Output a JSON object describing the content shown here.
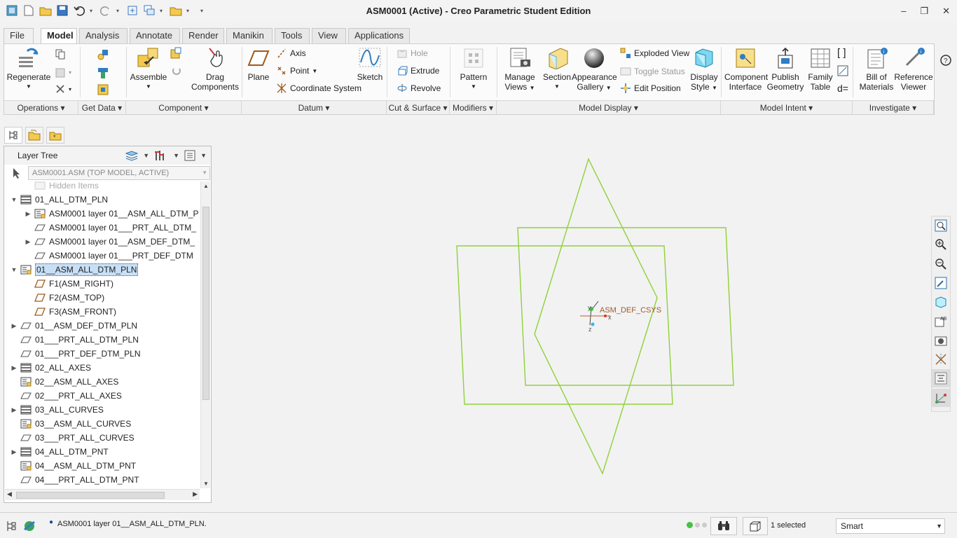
{
  "window": {
    "title": "ASM0001 (Active) - Creo Parametric Student Edition",
    "controls": [
      "–",
      "❐",
      "✕"
    ]
  },
  "menu_tabs": [
    {
      "label": "File",
      "dropdown": "▾"
    },
    {
      "label": "Model"
    },
    {
      "label": "Analysis"
    },
    {
      "label": "Annotate"
    },
    {
      "label": "Render"
    },
    {
      "label": "Manikin"
    },
    {
      "label": "Tools"
    },
    {
      "label": "View"
    },
    {
      "label": "Applications"
    }
  ],
  "ribbon": {
    "operations": {
      "regenerate": "Regenerate"
    },
    "component": {
      "assemble": "Assemble",
      "drag": [
        "Drag",
        "Components"
      ]
    },
    "datum": {
      "plane": "Plane",
      "axis": "Axis",
      "point": "Point",
      "csys": "Coordinate System",
      "sketch": "Sketch"
    },
    "cut_surface": {
      "hole": "Hole",
      "extrude": "Extrude",
      "revolve": "Revolve"
    },
    "modifiers": {
      "pattern": "Pattern"
    },
    "model_display": {
      "manage_views": [
        "Manage",
        "Views"
      ],
      "section": "Section",
      "appearance": [
        "Appearance",
        "Gallery"
      ],
      "exploded_view": "Exploded View",
      "toggle_status": "Toggle Status",
      "edit_position": "Edit Position",
      "display_style": [
        "Display",
        "Style"
      ]
    },
    "model_intent": {
      "component_interface": [
        "Component",
        "Interface"
      ],
      "publish_geometry": [
        "Publish",
        "Geometry"
      ],
      "family_table": [
        "Family",
        "Table"
      ],
      "d_eq": "d="
    },
    "investigate": {
      "bom": [
        "Bill of",
        "Materials"
      ],
      "reference_viewer": [
        "Reference",
        "Viewer"
      ]
    },
    "groups": [
      "Operations",
      "Get Data",
      "Component",
      "Datum",
      "Cut & Surface",
      "Modifiers",
      "Model Display",
      "Model Intent",
      "Investigate"
    ]
  },
  "layer_panel": {
    "title": "Layer Tree",
    "model": "ASM0001.ASM (TOP MODEL, ACTIVE)",
    "items": [
      {
        "label": "Hidden Items",
        "toggle": "",
        "icon": "layer-icon",
        "indent": 1,
        "faded": true
      },
      {
        "label": "01_ALL_DTM_PLN",
        "toggle": "▼",
        "icon": "layer-stack-icon",
        "indent": 0
      },
      {
        "label": "ASM0001 layer 01__ASM_ALL_DTM_P",
        "toggle": "▶",
        "icon": "sublayer-icon",
        "indent": 1
      },
      {
        "label": "ASM0001 layer 01___PRT_ALL_DTM_",
        "toggle": "",
        "icon": "plane-layer-icon",
        "indent": 1
      },
      {
        "label": "ASM0001 layer 01__ASM_DEF_DTM_",
        "toggle": "▶",
        "icon": "plane-layer-icon",
        "indent": 1
      },
      {
        "label": "ASM0001 layer 01___PRT_DEF_DTM",
        "toggle": "",
        "icon": "plane-layer-icon",
        "indent": 1
      },
      {
        "label": "01__ASM_ALL_DTM_PLN",
        "toggle": "▼",
        "icon": "sublayer-icon",
        "indent": 0,
        "selected": true
      },
      {
        "label": "F1(ASM_RIGHT)",
        "toggle": "",
        "icon": "datum-plane-icon",
        "indent": 1
      },
      {
        "label": "F2(ASM_TOP)",
        "toggle": "",
        "icon": "datum-plane-icon",
        "indent": 1
      },
      {
        "label": "F3(ASM_FRONT)",
        "toggle": "",
        "icon": "datum-plane-icon",
        "indent": 1
      },
      {
        "label": "01__ASM_DEF_DTM_PLN",
        "toggle": "▶",
        "icon": "plane-layer-icon",
        "indent": 0
      },
      {
        "label": "01___PRT_ALL_DTM_PLN",
        "toggle": "",
        "icon": "plane-layer-icon",
        "indent": 0
      },
      {
        "label": "01___PRT_DEF_DTM_PLN",
        "toggle": "",
        "icon": "plane-layer-icon",
        "indent": 0
      },
      {
        "label": "02_ALL_AXES",
        "toggle": "▶",
        "icon": "layer-stack-icon",
        "indent": 0
      },
      {
        "label": "02__ASM_ALL_AXES",
        "toggle": "",
        "icon": "sublayer-icon",
        "indent": 0
      },
      {
        "label": "02___PRT_ALL_AXES",
        "toggle": "",
        "icon": "plane-layer-icon",
        "indent": 0
      },
      {
        "label": "03_ALL_CURVES",
        "toggle": "▶",
        "icon": "layer-stack-icon",
        "indent": 0
      },
      {
        "label": "03__ASM_ALL_CURVES",
        "toggle": "",
        "icon": "sublayer-icon",
        "indent": 0
      },
      {
        "label": "03___PRT_ALL_CURVES",
        "toggle": "",
        "icon": "plane-layer-icon",
        "indent": 0
      },
      {
        "label": "04_ALL_DTM_PNT",
        "toggle": "▶",
        "icon": "layer-stack-icon",
        "indent": 0
      },
      {
        "label": "04__ASM_ALL_DTM_PNT",
        "toggle": "",
        "icon": "sublayer-icon",
        "indent": 0
      },
      {
        "label": "04___PRT_ALL_DTM_PNT",
        "toggle": "",
        "icon": "plane-layer-icon",
        "indent": 0
      }
    ]
  },
  "graphics": {
    "csys_label": "ASM_DEF_CSYS",
    "axis_x": "x",
    "axis_y": "y",
    "axis_z": "z",
    "datum_color": "#8fd13a"
  },
  "status": {
    "message": "ASM0001 layer 01__ASM_ALL_DTM_PLN.",
    "selected": "1 selected",
    "filter": "Smart"
  }
}
